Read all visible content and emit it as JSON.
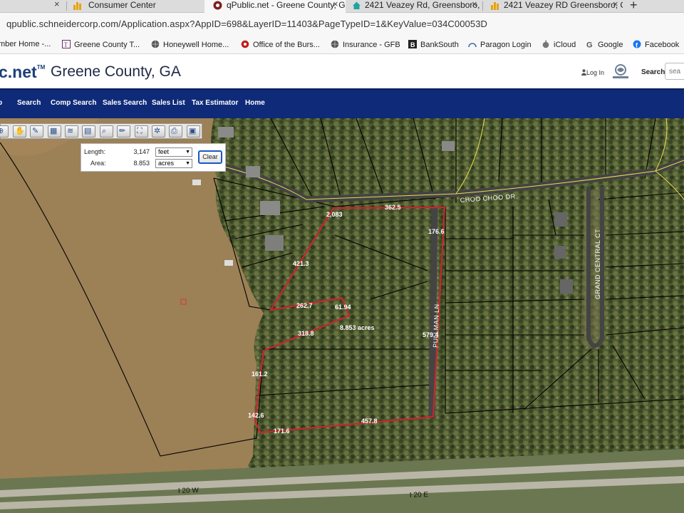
{
  "browser": {
    "tabs": [
      {
        "title": "Consumer Center",
        "active": false
      },
      {
        "title": "qPublic.net - Greene County, G",
        "active": true
      },
      {
        "title": "2421 Veazey Rd, Greensboro,",
        "active": false
      },
      {
        "title": "2421 Veazey RD Greensboro, G",
        "active": false
      }
    ],
    "new_tab": "+",
    "close_glyph": "×",
    "url": "qpublic.schneidercorp.com/Application.aspx?AppID=698&LayerID=11403&PageTypeID=1&KeyValue=034C00053D",
    "bookmarks": [
      {
        "label": "mber Home -...",
        "icon": "page-icon"
      },
      {
        "label": "Greene County T...",
        "icon": "greene-county-icon"
      },
      {
        "label": "Honeywell Home...",
        "icon": "globe-icon"
      },
      {
        "label": "Office of the Burs...",
        "icon": "office-icon"
      },
      {
        "label": "Insurance - GFB",
        "icon": "globe-icon"
      },
      {
        "label": "BankSouth",
        "icon": "banksouth-icon"
      },
      {
        "label": "Paragon Login",
        "icon": "paragon-icon"
      },
      {
        "label": "iCloud",
        "icon": "apple-icon"
      },
      {
        "label": "Google",
        "icon": "google-icon"
      },
      {
        "label": "Facebook",
        "icon": "facebook-icon"
      }
    ]
  },
  "site": {
    "logo": "c.net",
    "logo_mark": "TM",
    "county": "Greene County, GA",
    "login": "Log In",
    "search_label": "Search",
    "search_placeholder": "sea",
    "nav": [
      "p",
      "Search",
      "Comp Search",
      "Sales Search",
      "Sales List",
      "Tax Estimator",
      "Home"
    ]
  },
  "measure": {
    "length_label": "Length:",
    "length_value": "3,147",
    "length_unit": "feet",
    "area_label": "Area:",
    "area_value": "8.853",
    "area_unit": "acres",
    "clear_label": "Clear"
  },
  "map": {
    "road_labels": [
      "CHOO CHOO DR",
      "PULLMAN LN",
      "GRAND CENTRAL CT",
      "I 20 W",
      "I 20 E"
    ],
    "dimensions": [
      "362.5",
      "2,083",
      "176.6",
      "421.3",
      "262.7",
      "61.94",
      "318.8",
      "8.853 acres",
      "579.4",
      "161.2",
      "142.6",
      "171.6",
      "457.8"
    ],
    "colors": {
      "measure_line": "#c8262e",
      "parcel_line": "#000000",
      "lake": "#9a7d52",
      "forest": "#4d5a2e",
      "road_line": "#e8df4a"
    }
  }
}
